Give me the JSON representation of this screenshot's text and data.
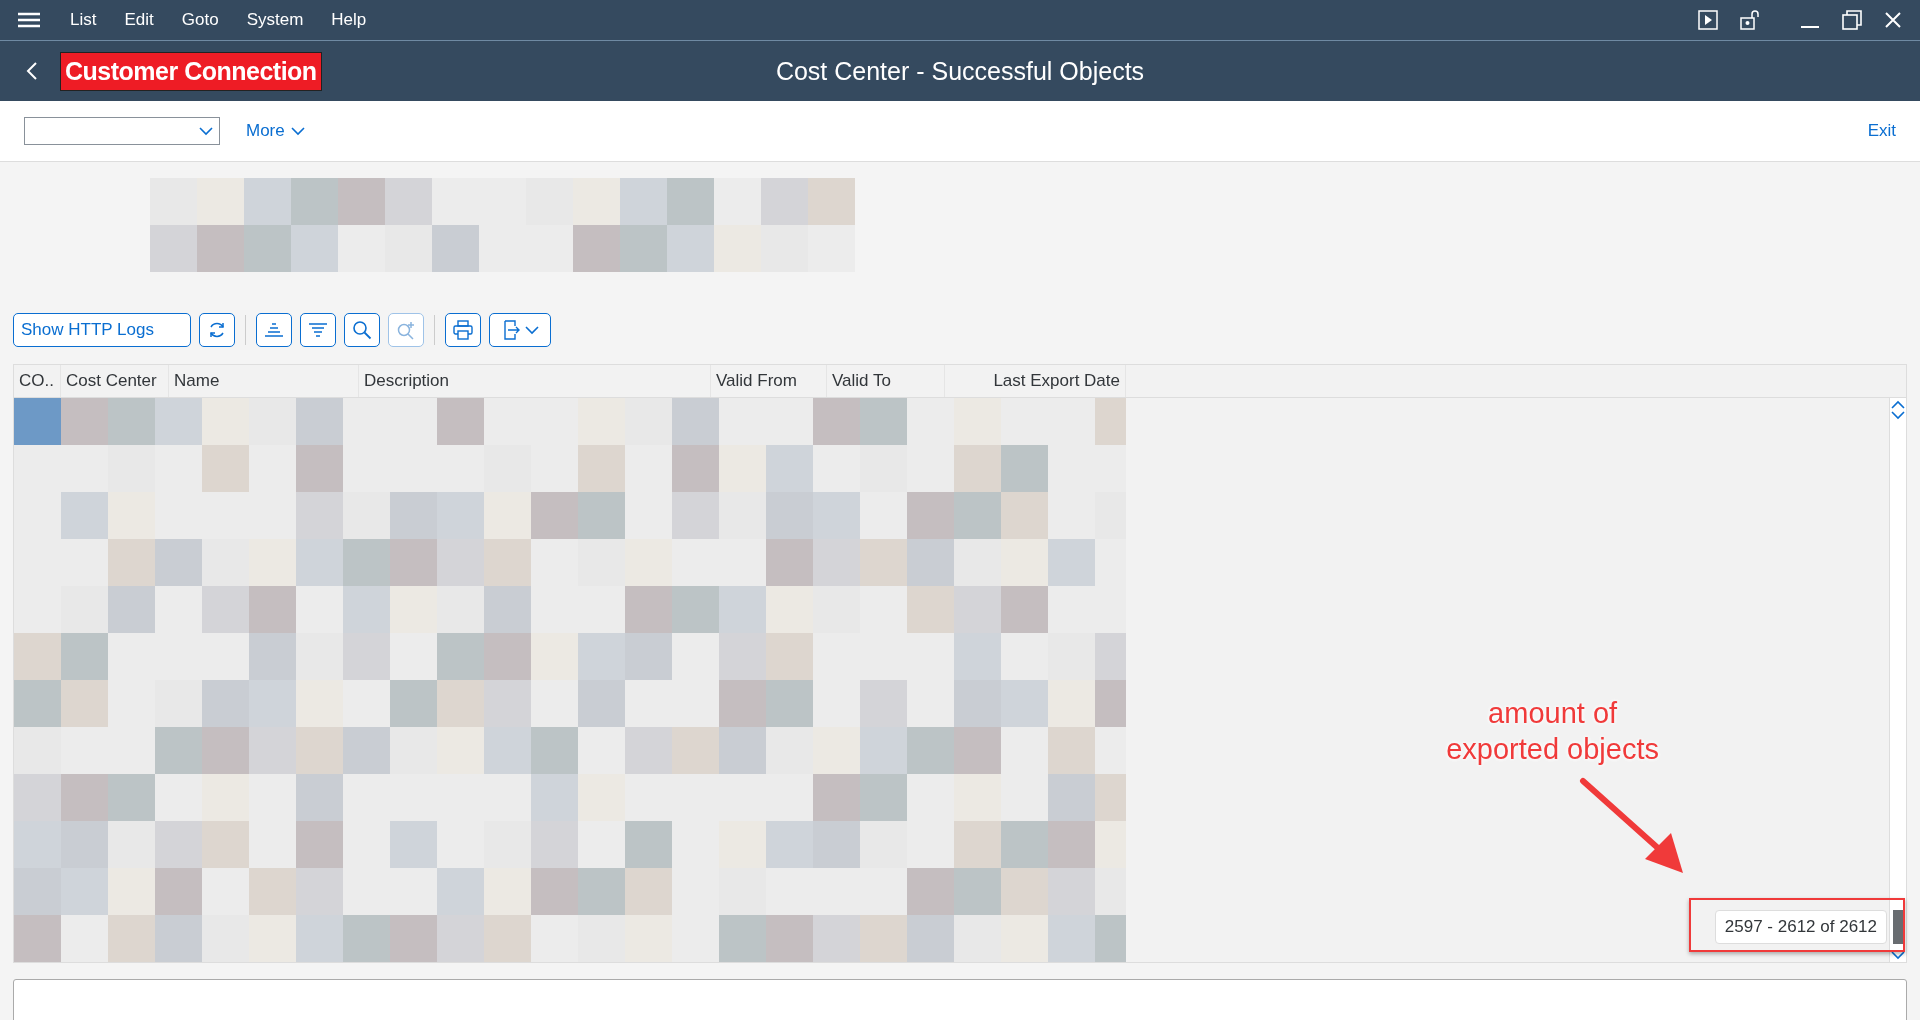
{
  "menu_bar": {
    "items": [
      "List",
      "Edit",
      "Goto",
      "System",
      "Help"
    ]
  },
  "title_bar": {
    "badge": "Customer Connection",
    "title": "Cost Center - Successful Objects"
  },
  "toolbar": {
    "more": "More",
    "exit": "Exit"
  },
  "alv_toolbar": {
    "button": "Show HTTP Logs"
  },
  "table": {
    "columns": [
      "CO..",
      "Cost Center",
      "Name",
      "Description",
      "Valid From",
      "Valid To",
      "Last Export Date"
    ]
  },
  "record_counter": "2597 - 2612 of 2612",
  "annotation": {
    "lines": [
      "amount of",
      "exported objects"
    ]
  }
}
